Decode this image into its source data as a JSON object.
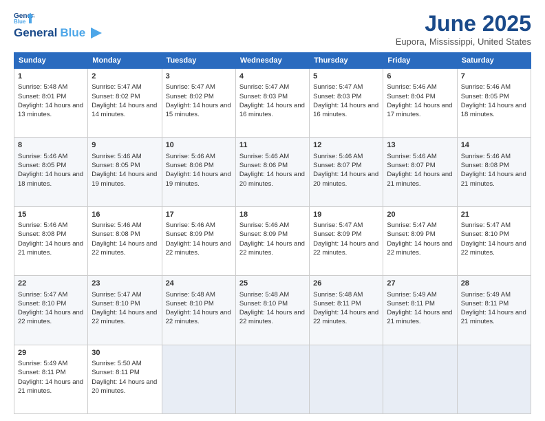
{
  "logo": {
    "line1": "General",
    "line2": "Blue",
    "icon_color": "#4da6e8"
  },
  "title": "June 2025",
  "subtitle": "Eupora, Mississippi, United States",
  "days": [
    "Sunday",
    "Monday",
    "Tuesday",
    "Wednesday",
    "Thursday",
    "Friday",
    "Saturday"
  ],
  "weeks": [
    [
      {
        "day": "1",
        "sunrise": "5:48 AM",
        "sunset": "8:01 PM",
        "daylight": "14 hours and 13 minutes."
      },
      {
        "day": "2",
        "sunrise": "5:47 AM",
        "sunset": "8:02 PM",
        "daylight": "14 hours and 14 minutes."
      },
      {
        "day": "3",
        "sunrise": "5:47 AM",
        "sunset": "8:02 PM",
        "daylight": "14 hours and 15 minutes."
      },
      {
        "day": "4",
        "sunrise": "5:47 AM",
        "sunset": "8:03 PM",
        "daylight": "14 hours and 16 minutes."
      },
      {
        "day": "5",
        "sunrise": "5:47 AM",
        "sunset": "8:03 PM",
        "daylight": "14 hours and 16 minutes."
      },
      {
        "day": "6",
        "sunrise": "5:46 AM",
        "sunset": "8:04 PM",
        "daylight": "14 hours and 17 minutes."
      },
      {
        "day": "7",
        "sunrise": "5:46 AM",
        "sunset": "8:05 PM",
        "daylight": "14 hours and 18 minutes."
      }
    ],
    [
      {
        "day": "8",
        "sunrise": "5:46 AM",
        "sunset": "8:05 PM",
        "daylight": "14 hours and 18 minutes."
      },
      {
        "day": "9",
        "sunrise": "5:46 AM",
        "sunset": "8:05 PM",
        "daylight": "14 hours and 19 minutes."
      },
      {
        "day": "10",
        "sunrise": "5:46 AM",
        "sunset": "8:06 PM",
        "daylight": "14 hours and 19 minutes."
      },
      {
        "day": "11",
        "sunrise": "5:46 AM",
        "sunset": "8:06 PM",
        "daylight": "14 hours and 20 minutes."
      },
      {
        "day": "12",
        "sunrise": "5:46 AM",
        "sunset": "8:07 PM",
        "daylight": "14 hours and 20 minutes."
      },
      {
        "day": "13",
        "sunrise": "5:46 AM",
        "sunset": "8:07 PM",
        "daylight": "14 hours and 21 minutes."
      },
      {
        "day": "14",
        "sunrise": "5:46 AM",
        "sunset": "8:08 PM",
        "daylight": "14 hours and 21 minutes."
      }
    ],
    [
      {
        "day": "15",
        "sunrise": "5:46 AM",
        "sunset": "8:08 PM",
        "daylight": "14 hours and 21 minutes."
      },
      {
        "day": "16",
        "sunrise": "5:46 AM",
        "sunset": "8:08 PM",
        "daylight": "14 hours and 22 minutes."
      },
      {
        "day": "17",
        "sunrise": "5:46 AM",
        "sunset": "8:09 PM",
        "daylight": "14 hours and 22 minutes."
      },
      {
        "day": "18",
        "sunrise": "5:46 AM",
        "sunset": "8:09 PM",
        "daylight": "14 hours and 22 minutes."
      },
      {
        "day": "19",
        "sunrise": "5:47 AM",
        "sunset": "8:09 PM",
        "daylight": "14 hours and 22 minutes."
      },
      {
        "day": "20",
        "sunrise": "5:47 AM",
        "sunset": "8:09 PM",
        "daylight": "14 hours and 22 minutes."
      },
      {
        "day": "21",
        "sunrise": "5:47 AM",
        "sunset": "8:10 PM",
        "daylight": "14 hours and 22 minutes."
      }
    ],
    [
      {
        "day": "22",
        "sunrise": "5:47 AM",
        "sunset": "8:10 PM",
        "daylight": "14 hours and 22 minutes."
      },
      {
        "day": "23",
        "sunrise": "5:47 AM",
        "sunset": "8:10 PM",
        "daylight": "14 hours and 22 minutes."
      },
      {
        "day": "24",
        "sunrise": "5:48 AM",
        "sunset": "8:10 PM",
        "daylight": "14 hours and 22 minutes."
      },
      {
        "day": "25",
        "sunrise": "5:48 AM",
        "sunset": "8:10 PM",
        "daylight": "14 hours and 22 minutes."
      },
      {
        "day": "26",
        "sunrise": "5:48 AM",
        "sunset": "8:11 PM",
        "daylight": "14 hours and 22 minutes."
      },
      {
        "day": "27",
        "sunrise": "5:49 AM",
        "sunset": "8:11 PM",
        "daylight": "14 hours and 21 minutes."
      },
      {
        "day": "28",
        "sunrise": "5:49 AM",
        "sunset": "8:11 PM",
        "daylight": "14 hours and 21 minutes."
      }
    ],
    [
      {
        "day": "29",
        "sunrise": "5:49 AM",
        "sunset": "8:11 PM",
        "daylight": "14 hours and 21 minutes."
      },
      {
        "day": "30",
        "sunrise": "5:50 AM",
        "sunset": "8:11 PM",
        "daylight": "14 hours and 20 minutes."
      },
      null,
      null,
      null,
      null,
      null
    ]
  ],
  "labels": {
    "sunrise": "Sunrise:",
    "sunset": "Sunset:",
    "daylight": "Daylight:"
  }
}
